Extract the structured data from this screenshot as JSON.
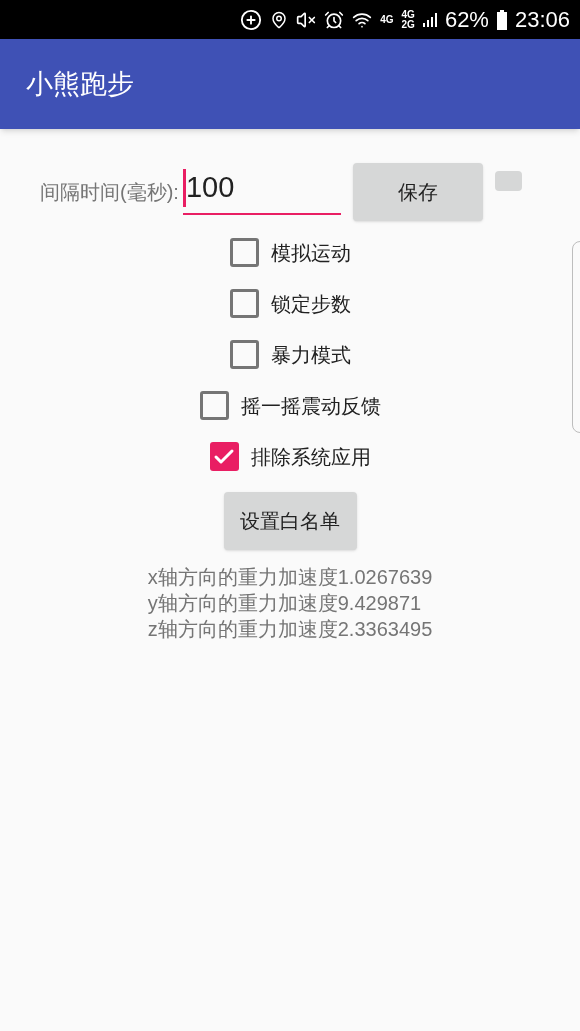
{
  "status_bar": {
    "network_1": "4G",
    "network_2_top": "4G",
    "network_2_bottom": "2G",
    "battery": "62%",
    "time": "23:06"
  },
  "app_bar": {
    "title": "小熊跑步"
  },
  "interval": {
    "label": "间隔时间(毫秒):",
    "value": "100",
    "save_button": "保存"
  },
  "options": [
    {
      "label": "模拟运动",
      "checked": false
    },
    {
      "label": "锁定步数",
      "checked": false
    },
    {
      "label": "暴力模式",
      "checked": false
    },
    {
      "label": "摇一摇震动反馈",
      "checked": false
    },
    {
      "label": "排除系统应用",
      "checked": true
    }
  ],
  "whitelist_button": "设置白名单",
  "readings": [
    "x轴方向的重力加速度1.0267639",
    "y轴方向的重力加速度9.429871",
    "z轴方向的重力加速度2.3363495"
  ]
}
